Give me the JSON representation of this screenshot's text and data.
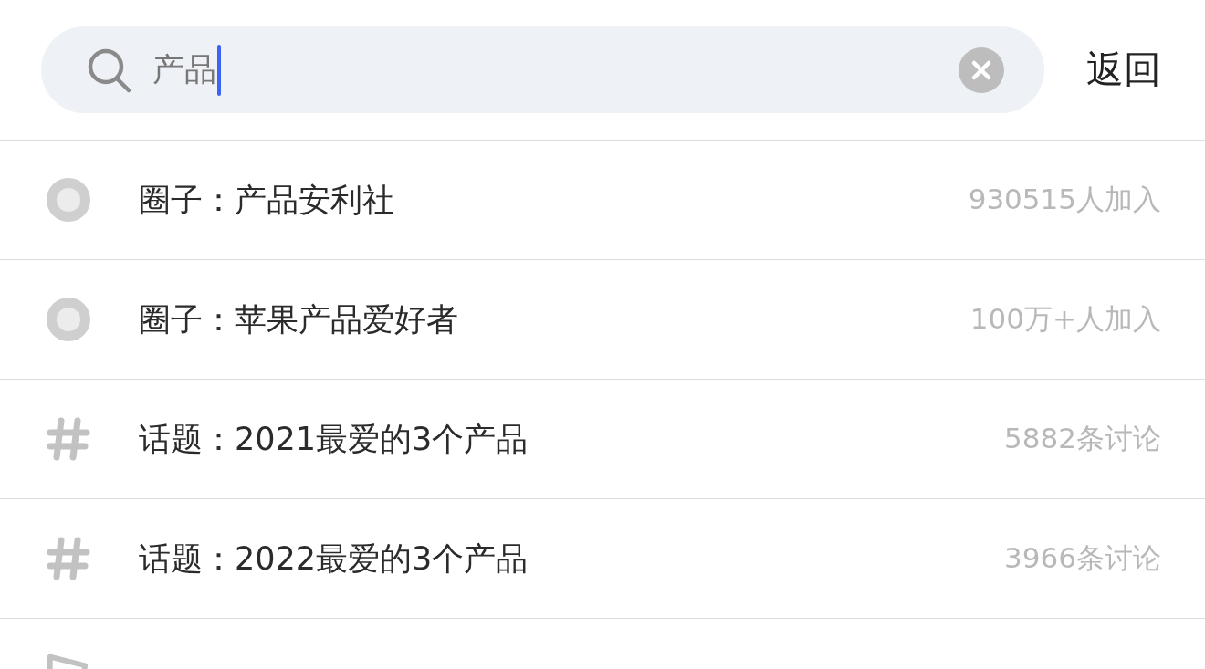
{
  "search": {
    "value": "产品",
    "back": "返回"
  },
  "results": [
    {
      "kind": "circle",
      "label": "圈子：产品安利社",
      "meta": "930515人加入"
    },
    {
      "kind": "circle",
      "label": "圈子：苹果产品爱好者",
      "meta": "100万+人加入"
    },
    {
      "kind": "topic",
      "label": "话题：2021最爱的3个产品",
      "meta": "5882条讨论"
    },
    {
      "kind": "topic",
      "label": "话题：2022最爱的3个产品",
      "meta": "3966条讨论"
    },
    {
      "kind": "post"
    }
  ]
}
